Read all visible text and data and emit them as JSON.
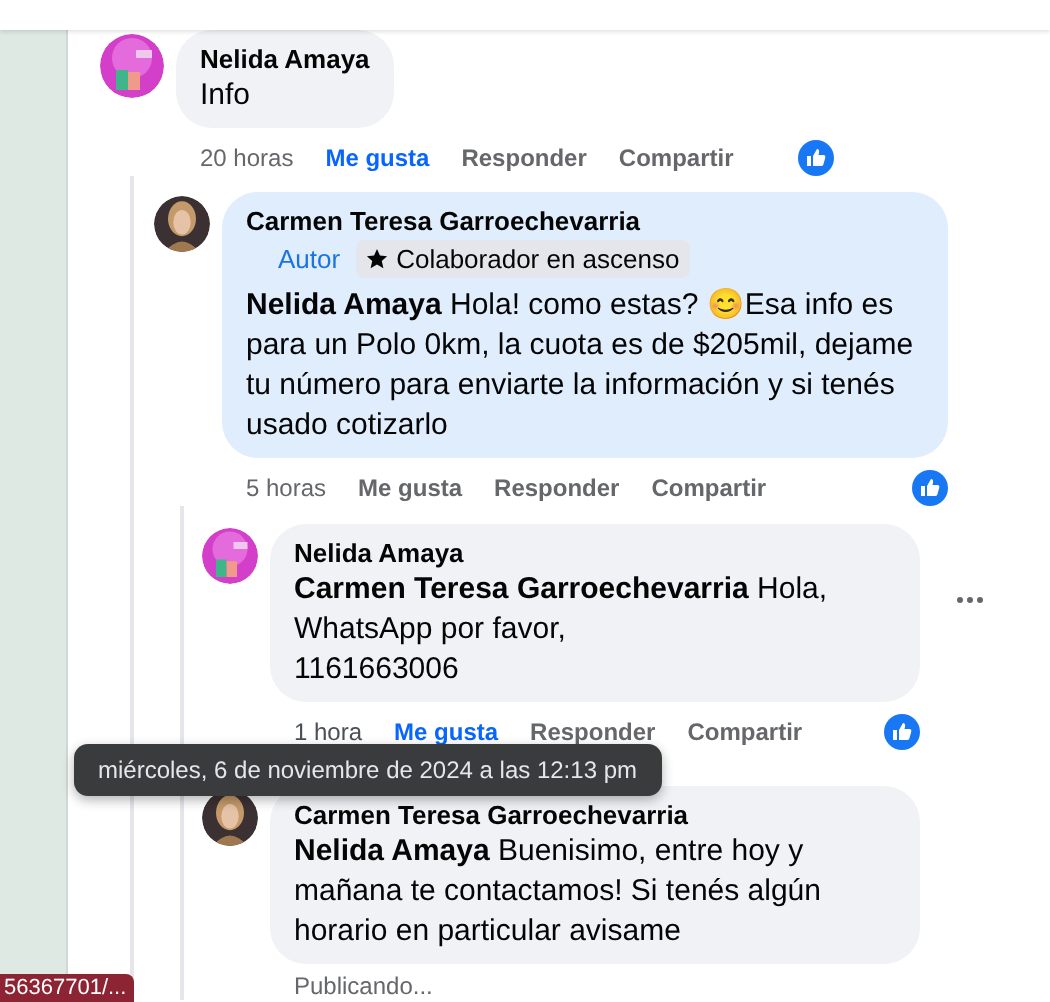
{
  "comments": [
    {
      "author": "Nelida Amaya",
      "highlighted": false,
      "text": "Info",
      "time": "20 horas",
      "time_hovered": false,
      "like": "Me gusta",
      "liked": true,
      "reply": "Responder",
      "share": "Compartir",
      "reaction": true,
      "replies": [
        {
          "author": "Carmen Teresa Garroechevarria",
          "highlighted": true,
          "badges": [
            {
              "kind": "author",
              "label": "Autor"
            },
            {
              "kind": "star",
              "label": "Colaborador en ascenso"
            }
          ],
          "text": "**Nelida Amaya** Hola! como estas? 😊Esa info es para un Polo 0km, la cuota es de $205mil, dejame tu número para enviarte la información y si tenés usado cotizarlo",
          "time": "5 horas",
          "time_hovered": false,
          "like": "Me gusta",
          "liked": false,
          "reply": "Responder",
          "share": "Compartir",
          "reaction": true,
          "replies": [
            {
              "author": "Nelida Amaya",
              "highlighted": false,
              "text": "**Carmen Teresa Garroechevarria** Hola, WhatsApp por favor,\n1161663006",
              "time": "1 hora",
              "time_hovered": true,
              "like": "Me gusta",
              "liked": true,
              "reply": "Responder",
              "share": "Compartir",
              "reaction": true,
              "menu": true
            },
            {
              "author": "Carmen Teresa Garroechevarria",
              "highlighted": false,
              "text": "**Nelida Amaya** Buenisimo, entre hoy y mañana te contactamos! Si tenés algún horario en particular avisame",
              "status": "Publicando..."
            }
          ]
        }
      ]
    }
  ],
  "tooltip": "miércoles, 6 de noviembre de 2024 a las 12:13 pm",
  "status_url": "56367701/..."
}
